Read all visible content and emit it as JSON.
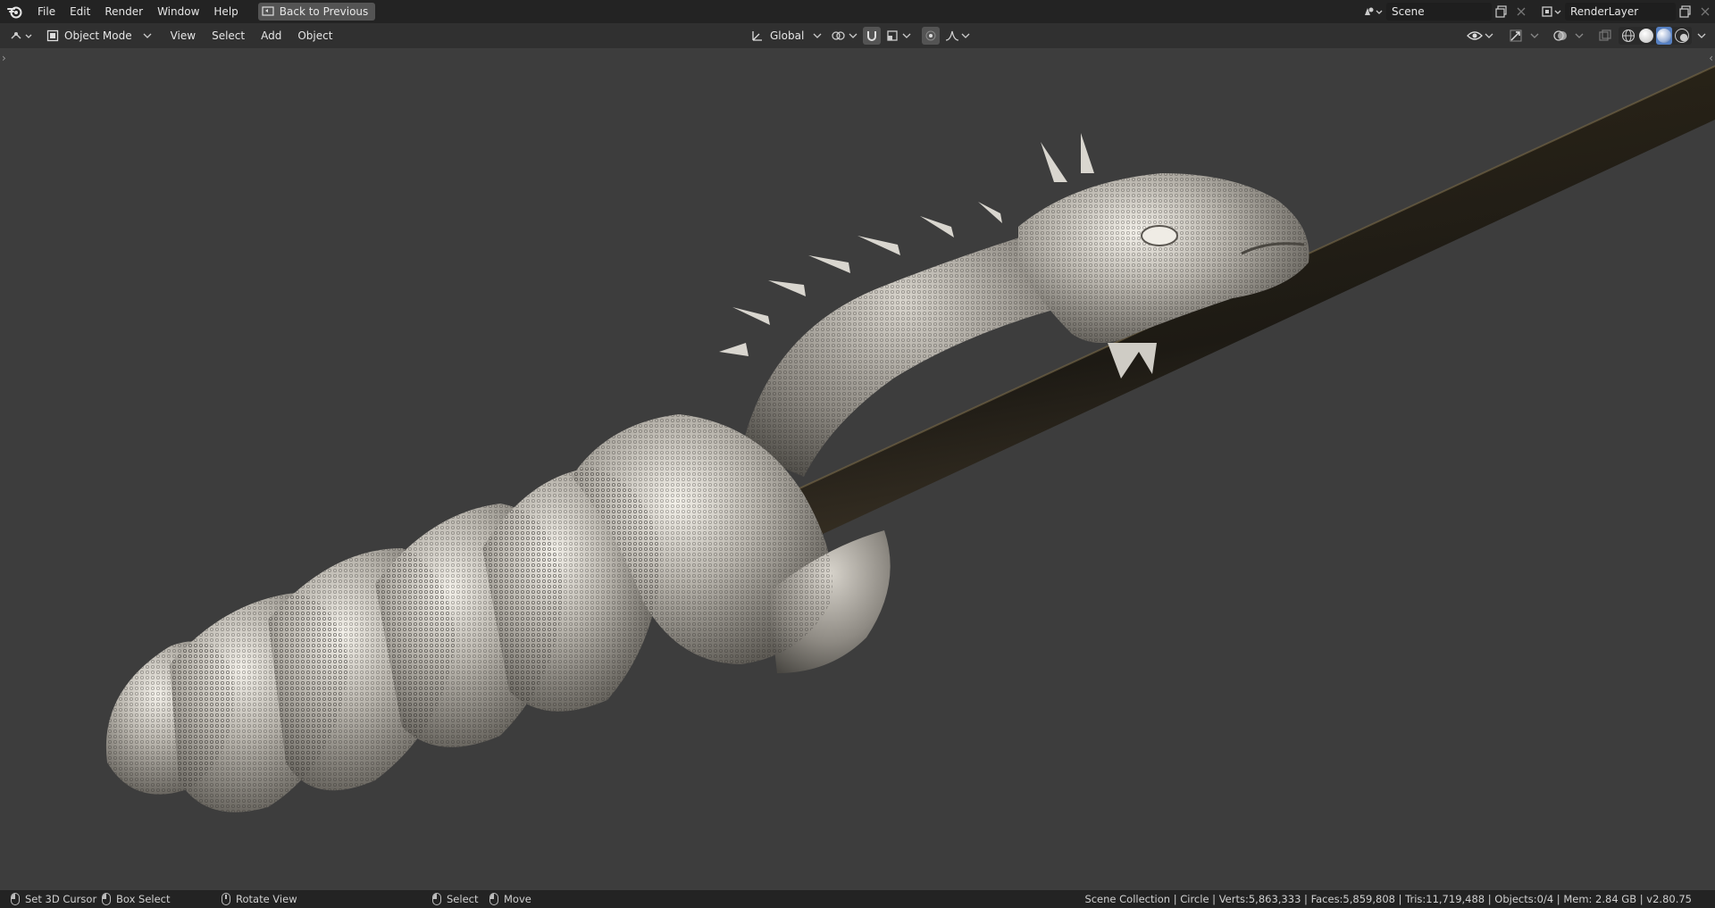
{
  "topbar": {
    "menus": [
      "File",
      "Edit",
      "Render",
      "Window",
      "Help"
    ],
    "back_button": "Back to Previous",
    "scene": "Scene",
    "render_layer": "RenderLayer"
  },
  "header": {
    "mode": "Object Mode",
    "menus": [
      "View",
      "Select",
      "Add",
      "Object"
    ],
    "orientation": "Global"
  },
  "status": {
    "items": [
      {
        "label": "Set 3D Cursor",
        "icon": "mouse-left-icon"
      },
      {
        "label": "Box Select",
        "icon": "mouse-drag-icon"
      },
      {
        "label": "Rotate View",
        "icon": "mouse-middle-icon"
      },
      {
        "label": "Select",
        "icon": "mouse-left-icon"
      },
      {
        "label": "Move",
        "icon": "mouse-drag-icon"
      }
    ],
    "stats": "Scene Collection | Circle | Verts:5,863,333 | Faces:5,859,808 | Tris:11,719,488 | Objects:0/4 | Mem: 2.84 GB | v2.80.75"
  },
  "colors": {
    "topbar": "#232323",
    "header": "#303030",
    "viewport": "#3d3d3d",
    "accent": "#5680c2",
    "sculpt_metal": "#b7b4ae",
    "staff": "#2a2418"
  }
}
